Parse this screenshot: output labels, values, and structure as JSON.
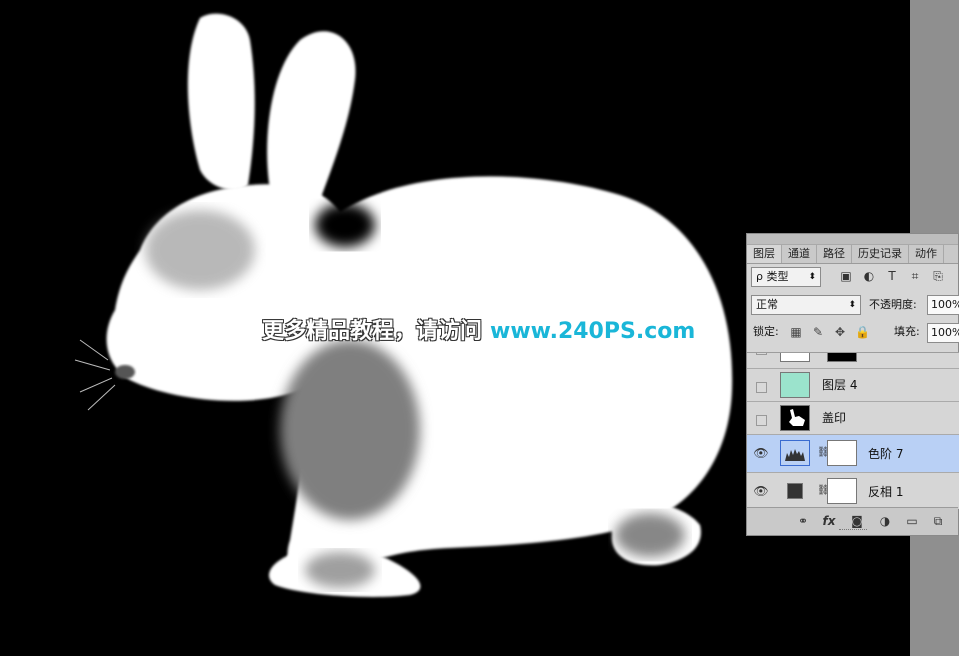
{
  "watermark": {
    "chinese": "更多精品教程，请访问",
    "url": "www.240PS.com"
  },
  "layers_panel": {
    "tabs": [
      "图层",
      "通道",
      "路径",
      "历史记录",
      "动作"
    ],
    "active_tab": "图层",
    "filter": {
      "label": "ρ 类型",
      "icons": [
        "image-filter-icon",
        "adjustment-filter-icon",
        "type-filter-icon",
        "shape-filter-icon",
        "smart-object-filter-icon"
      ]
    },
    "blend_mode": "正常",
    "opacity_label": "不透明度:",
    "opacity_value": "100%",
    "lock_label": "锁定:",
    "fill_label": "填充:",
    "fill_value": "100%",
    "layers": [
      {
        "name": "",
        "visible": false,
        "selected": false,
        "thumb_color": "#ffffff"
      },
      {
        "name": "图层 4",
        "visible": false,
        "selected": false,
        "thumb_color": "#9be3cc"
      },
      {
        "name": "盖印",
        "visible": false,
        "selected": false,
        "thumb_color": "#000000"
      },
      {
        "name": "色阶 7",
        "visible": true,
        "selected": true,
        "thumb_color": "#b9d0f5"
      },
      {
        "name": "反相 1",
        "visible": true,
        "selected": false,
        "thumb_color": "#ffffff"
      }
    ],
    "bottom_icons": [
      "link-layers-icon",
      "fx-icon",
      "add-mask-icon",
      "new-adjustment-icon",
      "new-group-icon",
      "new-layer-icon"
    ],
    "fx_text": "fx"
  },
  "colors": {
    "canvas_bg": "#000000",
    "selected_layer": "#b9d0f5",
    "url_color": "#1ab6d8"
  }
}
